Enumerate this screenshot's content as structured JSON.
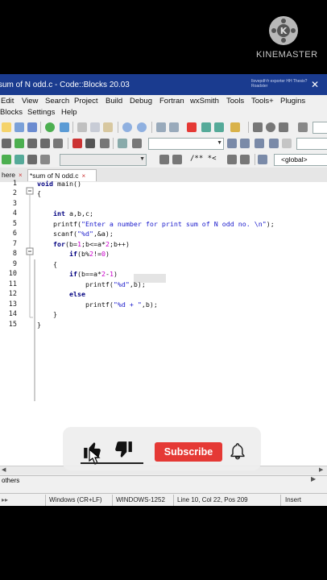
{
  "watermark": {
    "brand": "KINEMASTER"
  },
  "window": {
    "title": "sum of N odd.c - Code::Blocks 20.03",
    "title_right_text": "Ilovepdf-fr exporter HH Thesix? Roadster"
  },
  "menu": {
    "row1": [
      "Edit",
      "View",
      "Search",
      "Project",
      "Build",
      "Debug",
      "Fortran",
      "wxSmith",
      "Tools",
      "Tools+",
      "Plugins"
    ],
    "row2": [
      "Blocks",
      "Settings",
      "Help"
    ]
  },
  "toolbar": {
    "scope_combo": "",
    "symbol_combo": "<global>",
    "comment_label": "/** *<"
  },
  "tabs": [
    {
      "label": "here",
      "close": "×",
      "active": false
    },
    {
      "label": "*sum of N odd.c",
      "close": "×",
      "active": true
    }
  ],
  "editor": {
    "line_numbers": [
      "1",
      "2",
      "3",
      "4",
      "5",
      "6",
      "7",
      "8",
      "9",
      "10",
      "11",
      "12",
      "13",
      "14",
      "15"
    ],
    "lines": [
      "void main()",
      "{",
      "",
      "    int a,b,c;",
      "    printf(\"Enter a number for print sum of N odd no. \\n\");",
      "    scanf(\"%d\",&a);",
      "    for(b=1;b<=a*2;b++)",
      "        if(b%2!=0)",
      "    {",
      "        if(b==a*2-1)",
      "            printf(\"%d\",b);",
      "        else",
      "            printf(\"%d + \",b);",
      "    }",
      "}"
    ]
  },
  "log_panel": {
    "label": "others"
  },
  "status": {
    "line_ending": "Windows (CR+LF)",
    "encoding": "WINDOWS-1252",
    "position": "Line 10, Col 22, Pos 209",
    "mode": "Insert"
  },
  "overlay": {
    "subscribe_label": "Subscribe",
    "like_icon": "thumbs-up-icon",
    "dislike_icon": "thumbs-down-icon",
    "bell_icon": "bell-icon"
  },
  "colors": {
    "titlebar": "#1a3b8f",
    "keyword": "#000080",
    "string": "#1a1acc",
    "subscribe": "#e53935"
  }
}
